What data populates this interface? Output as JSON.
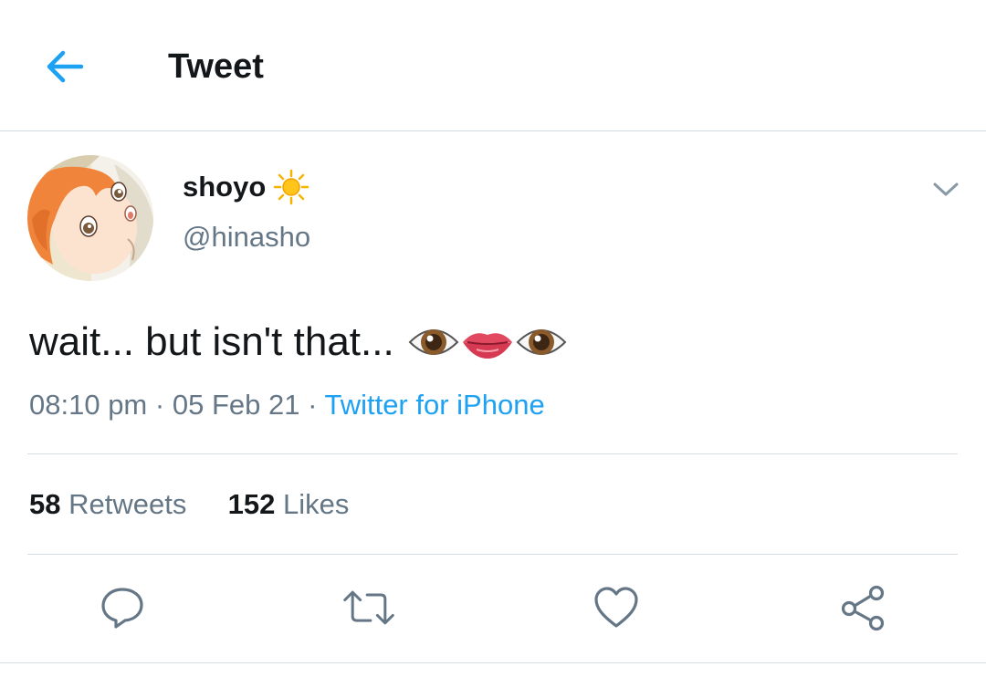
{
  "header": {
    "title": "Tweet",
    "back_icon": "arrow-left-icon"
  },
  "tweet": {
    "display_name": "shoyo",
    "name_emoji": "sun-icon",
    "handle": "@hinasho",
    "text": "wait... but isn't that...",
    "text_emojis": [
      "eye-icon",
      "mouth-icon",
      "eye-icon"
    ],
    "time": "08:10 pm",
    "separator": "·",
    "date": "05 Feb 21",
    "source": "Twitter for iPhone",
    "retweets_count": "58",
    "retweets_label": "Retweets",
    "likes_count": "152",
    "likes_label": "Likes"
  },
  "actions": [
    "reply-icon",
    "retweet-icon",
    "like-icon",
    "share-icon"
  ],
  "colors": {
    "accent": "#1da1f2",
    "text": "#14171a",
    "secondary": "#657786",
    "icon": "#657786",
    "divider": "#d6dde2"
  }
}
